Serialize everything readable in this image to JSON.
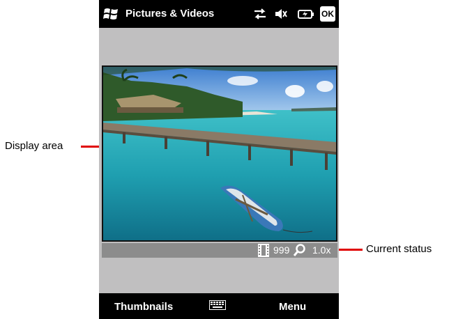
{
  "titlebar": {
    "title": "Pictures & Videos",
    "ok_label": "OK",
    "icons": [
      "windows-logo-icon",
      "connectivity-icon",
      "volume-muted-icon",
      "battery-icon"
    ]
  },
  "status": {
    "count": "999",
    "zoom": "1.0x"
  },
  "softkeys": {
    "left": "Thumbnails",
    "right": "Menu",
    "center_icon": "keyboard-icon"
  },
  "callouts": {
    "display": "Display area",
    "status": "Current status"
  },
  "colors": {
    "callout": "#e00000",
    "screen_bg": "#c0bfc0",
    "status_bg": "#8c8c8c",
    "bars": "#000000"
  }
}
